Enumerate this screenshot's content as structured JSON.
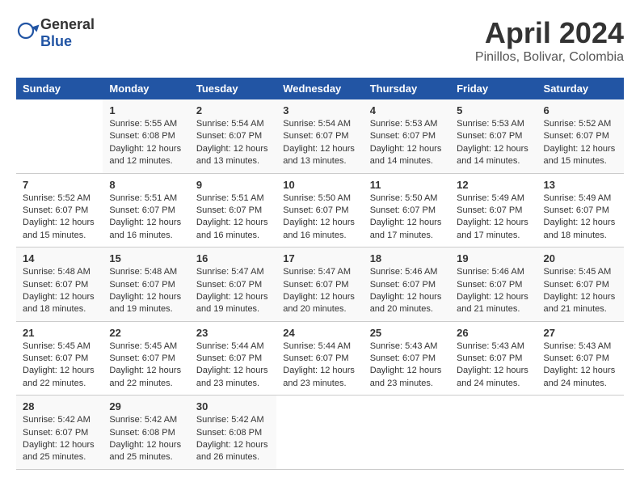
{
  "header": {
    "logo_general": "General",
    "logo_blue": "Blue",
    "title": "April 2024",
    "subtitle": "Pinillos, Bolivar, Colombia"
  },
  "calendar": {
    "days_of_week": [
      "Sunday",
      "Monday",
      "Tuesday",
      "Wednesday",
      "Thursday",
      "Friday",
      "Saturday"
    ],
    "weeks": [
      [
        {
          "day": "",
          "info": ""
        },
        {
          "day": "1",
          "sunrise": "5:55 AM",
          "sunset": "6:08 PM",
          "daylight": "12 hours and 12 minutes."
        },
        {
          "day": "2",
          "sunrise": "5:54 AM",
          "sunset": "6:07 PM",
          "daylight": "12 hours and 13 minutes."
        },
        {
          "day": "3",
          "sunrise": "5:54 AM",
          "sunset": "6:07 PM",
          "daylight": "12 hours and 13 minutes."
        },
        {
          "day": "4",
          "sunrise": "5:53 AM",
          "sunset": "6:07 PM",
          "daylight": "12 hours and 14 minutes."
        },
        {
          "day": "5",
          "sunrise": "5:53 AM",
          "sunset": "6:07 PM",
          "daylight": "12 hours and 14 minutes."
        },
        {
          "day": "6",
          "sunrise": "5:52 AM",
          "sunset": "6:07 PM",
          "daylight": "12 hours and 15 minutes."
        }
      ],
      [
        {
          "day": "7",
          "sunrise": "5:52 AM",
          "sunset": "6:07 PM",
          "daylight": "12 hours and 15 minutes."
        },
        {
          "day": "8",
          "sunrise": "5:51 AM",
          "sunset": "6:07 PM",
          "daylight": "12 hours and 16 minutes."
        },
        {
          "day": "9",
          "sunrise": "5:51 AM",
          "sunset": "6:07 PM",
          "daylight": "12 hours and 16 minutes."
        },
        {
          "day": "10",
          "sunrise": "5:50 AM",
          "sunset": "6:07 PM",
          "daylight": "12 hours and 16 minutes."
        },
        {
          "day": "11",
          "sunrise": "5:50 AM",
          "sunset": "6:07 PM",
          "daylight": "12 hours and 17 minutes."
        },
        {
          "day": "12",
          "sunrise": "5:49 AM",
          "sunset": "6:07 PM",
          "daylight": "12 hours and 17 minutes."
        },
        {
          "day": "13",
          "sunrise": "5:49 AM",
          "sunset": "6:07 PM",
          "daylight": "12 hours and 18 minutes."
        }
      ],
      [
        {
          "day": "14",
          "sunrise": "5:48 AM",
          "sunset": "6:07 PM",
          "daylight": "12 hours and 18 minutes."
        },
        {
          "day": "15",
          "sunrise": "5:48 AM",
          "sunset": "6:07 PM",
          "daylight": "12 hours and 19 minutes."
        },
        {
          "day": "16",
          "sunrise": "5:47 AM",
          "sunset": "6:07 PM",
          "daylight": "12 hours and 19 minutes."
        },
        {
          "day": "17",
          "sunrise": "5:47 AM",
          "sunset": "6:07 PM",
          "daylight": "12 hours and 20 minutes."
        },
        {
          "day": "18",
          "sunrise": "5:46 AM",
          "sunset": "6:07 PM",
          "daylight": "12 hours and 20 minutes."
        },
        {
          "day": "19",
          "sunrise": "5:46 AM",
          "sunset": "6:07 PM",
          "daylight": "12 hours and 21 minutes."
        },
        {
          "day": "20",
          "sunrise": "5:45 AM",
          "sunset": "6:07 PM",
          "daylight": "12 hours and 21 minutes."
        }
      ],
      [
        {
          "day": "21",
          "sunrise": "5:45 AM",
          "sunset": "6:07 PM",
          "daylight": "12 hours and 22 minutes."
        },
        {
          "day": "22",
          "sunrise": "5:45 AM",
          "sunset": "6:07 PM",
          "daylight": "12 hours and 22 minutes."
        },
        {
          "day": "23",
          "sunrise": "5:44 AM",
          "sunset": "6:07 PM",
          "daylight": "12 hours and 23 minutes."
        },
        {
          "day": "24",
          "sunrise": "5:44 AM",
          "sunset": "6:07 PM",
          "daylight": "12 hours and 23 minutes."
        },
        {
          "day": "25",
          "sunrise": "5:43 AM",
          "sunset": "6:07 PM",
          "daylight": "12 hours and 23 minutes."
        },
        {
          "day": "26",
          "sunrise": "5:43 AM",
          "sunset": "6:07 PM",
          "daylight": "12 hours and 24 minutes."
        },
        {
          "day": "27",
          "sunrise": "5:43 AM",
          "sunset": "6:07 PM",
          "daylight": "12 hours and 24 minutes."
        }
      ],
      [
        {
          "day": "28",
          "sunrise": "5:42 AM",
          "sunset": "6:07 PM",
          "daylight": "12 hours and 25 minutes."
        },
        {
          "day": "29",
          "sunrise": "5:42 AM",
          "sunset": "6:08 PM",
          "daylight": "12 hours and 25 minutes."
        },
        {
          "day": "30",
          "sunrise": "5:42 AM",
          "sunset": "6:08 PM",
          "daylight": "12 hours and 26 minutes."
        },
        {
          "day": "",
          "info": ""
        },
        {
          "day": "",
          "info": ""
        },
        {
          "day": "",
          "info": ""
        },
        {
          "day": "",
          "info": ""
        }
      ]
    ]
  }
}
